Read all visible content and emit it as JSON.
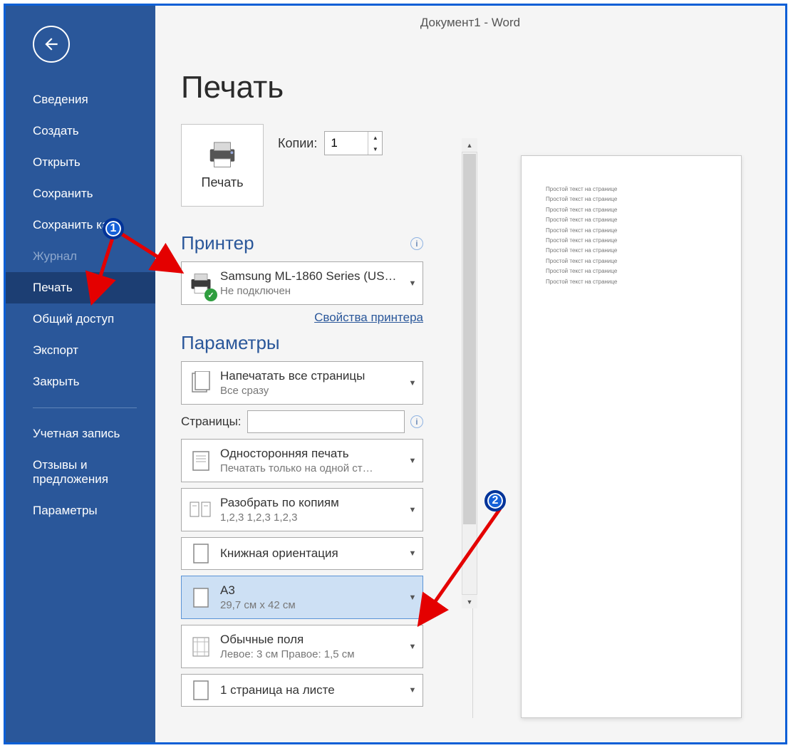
{
  "title": "Документ1  -  Word",
  "sidebar": {
    "items": [
      {
        "label": "Сведения"
      },
      {
        "label": "Создать"
      },
      {
        "label": "Открыть"
      },
      {
        "label": "Сохранить"
      },
      {
        "label": "Сохранить как"
      },
      {
        "label": "Журнал",
        "disabled": true
      },
      {
        "label": "Печать",
        "selected": true
      },
      {
        "label": "Общий доступ"
      },
      {
        "label": "Экспорт"
      },
      {
        "label": "Закрыть"
      }
    ],
    "footer": [
      {
        "label": "Учетная запись"
      },
      {
        "label": "Отзывы и предложения"
      },
      {
        "label": "Параметры"
      }
    ]
  },
  "print": {
    "page_title": "Печать",
    "button_label": "Печать",
    "copies_label": "Копии:",
    "copies_value": "1",
    "printer_heading": "Принтер",
    "printer_name": "Samsung ML-1860 Series (US…",
    "printer_status": "Не подключен",
    "printer_props": "Свойства принтера",
    "params_heading": "Параметры",
    "pages_label": "Страницы:",
    "pages_value": "",
    "settings": [
      {
        "title": "Напечатать все страницы",
        "sub": "Все сразу"
      },
      {
        "title": "Односторонняя печать",
        "sub": "Печатать только на одной ст…"
      },
      {
        "title": "Разобрать по копиям",
        "sub": "1,2,3    1,2,3    1,2,3"
      },
      {
        "title": "Книжная ориентация",
        "sub": ""
      },
      {
        "title": "A3",
        "sub": "29,7 см x 42 см",
        "highlight": true
      },
      {
        "title": "Обычные поля",
        "sub": "Левое:  3 см    Правое:  1,5 см"
      },
      {
        "title": "1 страница на листе",
        "sub": ""
      }
    ]
  },
  "preview": {
    "line": "Простой текст на странице",
    "line_count": 10
  },
  "annotations": {
    "callouts": [
      "1",
      "2"
    ]
  }
}
